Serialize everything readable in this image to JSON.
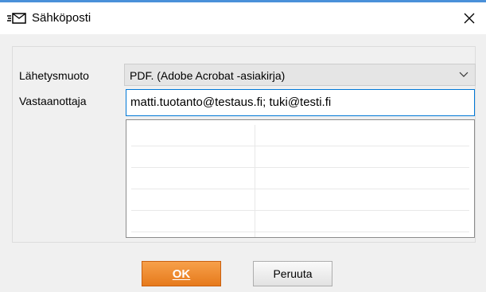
{
  "window": {
    "title": "Sähköposti",
    "title_icon": "email-send-icon",
    "close_icon": "close-icon"
  },
  "form": {
    "format_label": "Lähetysmuoto",
    "format_value": "PDF. (Adobe Acrobat -asiakirja)",
    "recipient_label": "Vastaanottaja",
    "recipient_value": "matti.tuotanto@testaus.fi; tuki@testi.fi"
  },
  "grid": {
    "rows": [
      [
        "",
        ""
      ],
      [
        "",
        ""
      ],
      [
        "",
        ""
      ],
      [
        "",
        ""
      ],
      [
        "",
        ""
      ],
      [
        "",
        ""
      ]
    ]
  },
  "buttons": {
    "ok_label": "OK",
    "cancel_label": "Peruuta"
  },
  "colors": {
    "accent": "#4a90d9",
    "ok_button": "#ee8a30",
    "focus_border": "#0078d7"
  }
}
